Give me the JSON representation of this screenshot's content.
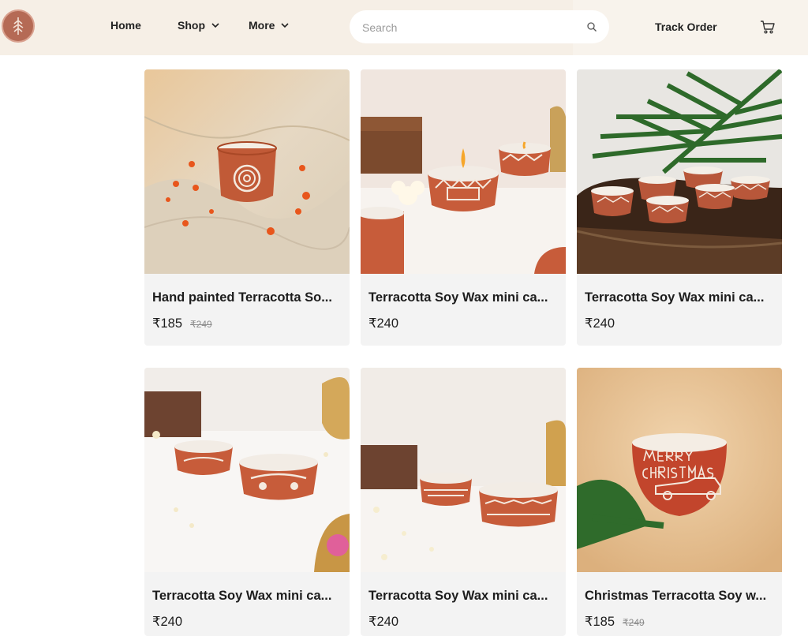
{
  "header": {
    "nav": [
      {
        "label": "Home"
      },
      {
        "label": "Shop"
      },
      {
        "label": "More"
      }
    ],
    "search": {
      "placeholder": "Search",
      "value": ""
    },
    "track_order_label": "Track Order",
    "icons": [
      "logo",
      "chevron-down-icon",
      "search-icon",
      "cart-icon"
    ]
  },
  "products": [
    {
      "title": "Hand painted Terracotta So...",
      "price": "₹185",
      "mrp": "₹249"
    },
    {
      "title": "Terracotta Soy Wax mini ca...",
      "price": "₹240"
    },
    {
      "title": "Terracotta Soy Wax mini ca...",
      "price": "₹240"
    },
    {
      "title": "Terracotta Soy Wax mini ca...",
      "price": "₹240"
    },
    {
      "title": "Terracotta Soy Wax mini ca...",
      "price": "₹240"
    },
    {
      "title": "Christmas Terracotta Soy w...",
      "price": "₹185",
      "mrp": "₹249"
    }
  ],
  "colors": {
    "header_bg": "#f6efe6",
    "card_bg": "#f3f3f3",
    "terracotta": "#c15a37",
    "logo": "#b56a55"
  }
}
